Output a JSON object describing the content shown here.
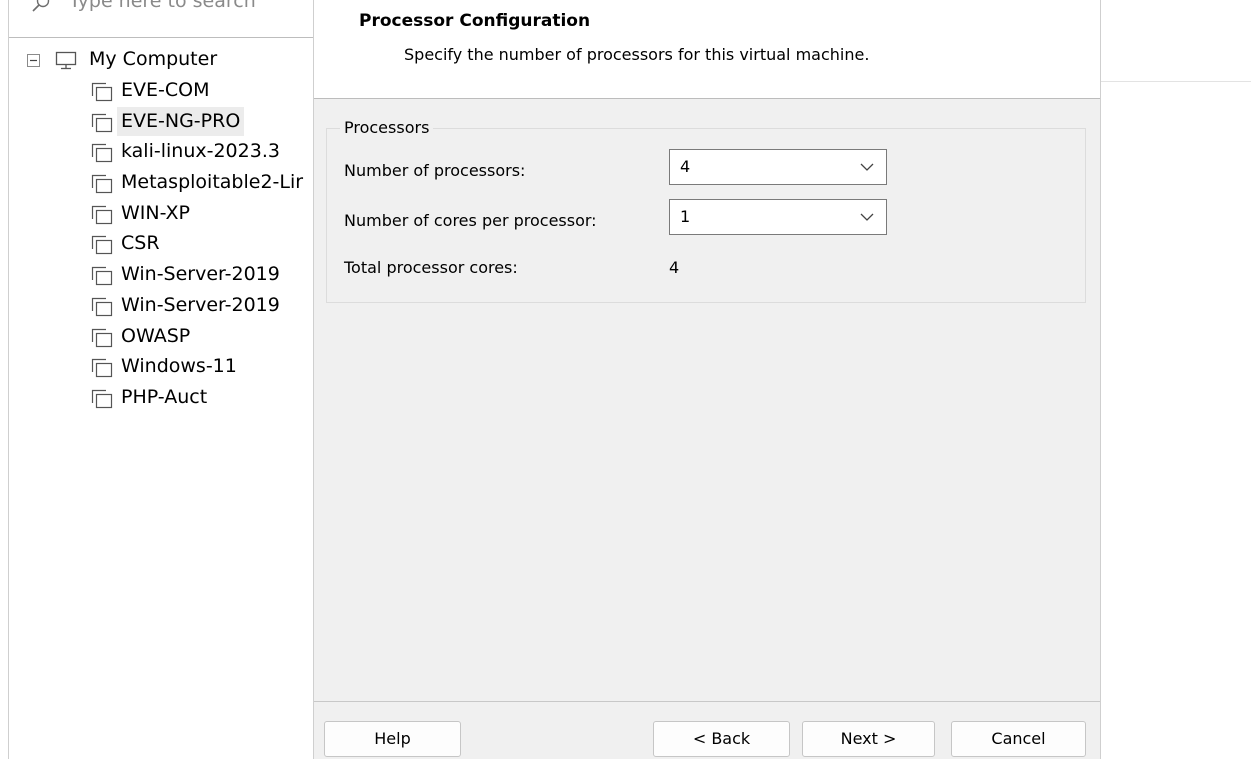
{
  "sidebar": {
    "search_placeholder": "Type here to search",
    "root_label": "My Computer",
    "items": [
      {
        "label": "EVE-COM",
        "selected": false
      },
      {
        "label": "EVE-NG-PRO",
        "selected": true
      },
      {
        "label": "kali-linux-2023.3",
        "selected": false
      },
      {
        "label": "Metasploitable2-Lir",
        "selected": false
      },
      {
        "label": "WIN-XP",
        "selected": false
      },
      {
        "label": "CSR",
        "selected": false
      },
      {
        "label": "Win-Server-2019",
        "selected": false
      },
      {
        "label": "Win-Server-2019",
        "selected": false
      },
      {
        "label": "OWASP",
        "selected": false
      },
      {
        "label": "Windows-11",
        "selected": false
      },
      {
        "label": "PHP-Auct",
        "selected": false
      }
    ]
  },
  "wizard": {
    "title": "Processor Configuration",
    "subtitle": "Specify the number of processors for this virtual machine.",
    "group_label": "Processors",
    "num_processors_label": "Number of processors:",
    "num_processors_value": "4",
    "cores_per_processor_label": "Number of cores per processor:",
    "cores_per_processor_value": "1",
    "total_cores_label": "Total processor cores:",
    "total_cores_value": "4"
  },
  "buttons": {
    "help": "Help",
    "back": "< Back",
    "next": "Next >",
    "cancel": "Cancel"
  },
  "icons": {
    "search": "search-icon",
    "collapse": "collapse-icon",
    "computer": "computer-icon",
    "vm": "vm-icon",
    "dropdown": "chevron-down-icon"
  }
}
